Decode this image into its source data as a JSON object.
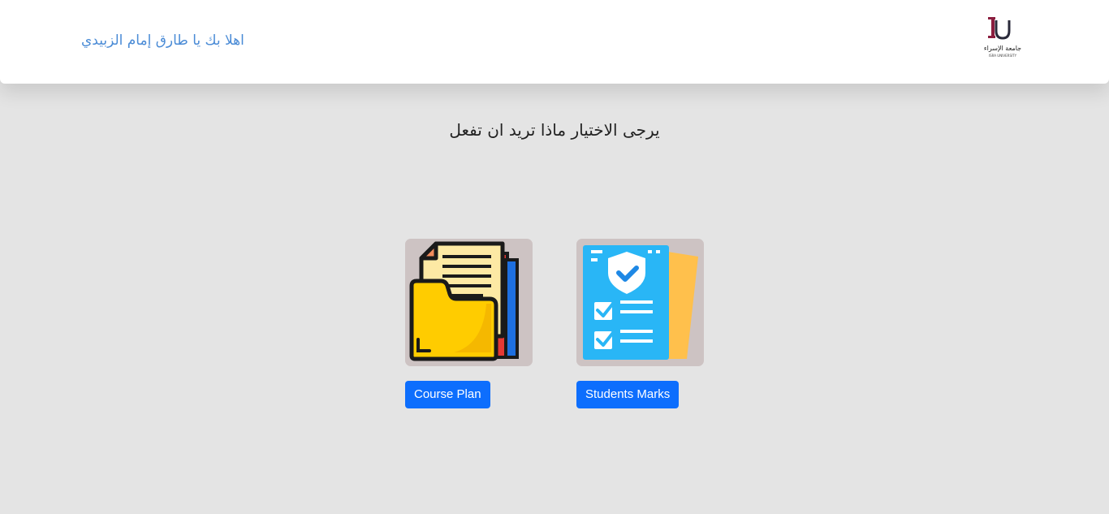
{
  "header": {
    "welcome_text": "اهلا بك يا طارق إمام الزبيدي",
    "logo": {
      "icon": "university-logo-icon",
      "brand_text": "جامعة الإسراء",
      "sub_text": "ISRA UNIVERSITY"
    }
  },
  "main": {
    "prompt": "يرجى الاختيار ماذا تريد ان تفعل",
    "options": [
      {
        "icon": "folder-documents-icon",
        "label": "Course Plan"
      },
      {
        "icon": "checklist-shield-icon",
        "label": "Students Marks"
      }
    ]
  },
  "colors": {
    "background": "#e4e4e4",
    "accent": "#0d6efd",
    "welcome": "#4a8bd6",
    "tile": "#cdc3c3"
  }
}
